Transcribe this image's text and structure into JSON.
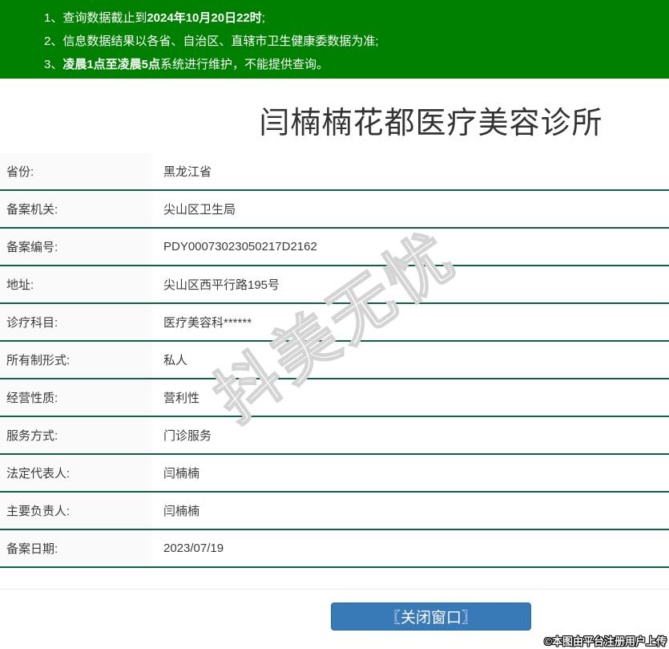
{
  "banner": {
    "notices": [
      {
        "prefix": "1、查询数据截止到",
        "bold": "2024年10月20日22时",
        "suffix": ";"
      },
      {
        "prefix": "2、信息数据结果以各省、自治区、直辖市卫生健康委数据为准;",
        "bold": "",
        "suffix": ""
      },
      {
        "prefix": "3、",
        "bold": "凌晨1点至凌晨5点",
        "suffix": "系统进行维护，不能提供查询。"
      }
    ]
  },
  "title": "闫楠楠花都医疗美容诊所",
  "table": {
    "rows": [
      {
        "label": "省份:",
        "value": "黑龙江省"
      },
      {
        "label": "备案机关:",
        "value": "尖山区卫生局"
      },
      {
        "label": "备案编号:",
        "value": "PDY00073023050217D2162"
      },
      {
        "label": "地址:",
        "value": "尖山区西平行路195号"
      },
      {
        "label": "诊疗科目:",
        "value": "医疗美容科******"
      },
      {
        "label": "所有制形式:",
        "value": "私人"
      },
      {
        "label": "经营性质:",
        "value": "营利性"
      },
      {
        "label": "服务方式:",
        "value": "门诊服务"
      },
      {
        "label": "法定代表人:",
        "value": "闫楠楠"
      },
      {
        "label": "主要负责人:",
        "value": "闫楠楠"
      },
      {
        "label": "备案日期:",
        "value": "2023/07/19"
      }
    ]
  },
  "watermark": "抖美无忧",
  "footer": {
    "close_button": "〖关闭窗口〗",
    "credit": "©本图由平台注册用户上传"
  },
  "colors": {
    "banner_green": "#008000",
    "row_border_green": "#0e6343",
    "label_bg": "#fafafa",
    "button_blue": "#3879b8",
    "button_border": "#2e6da4",
    "text_dark": "#3b3b3b"
  }
}
